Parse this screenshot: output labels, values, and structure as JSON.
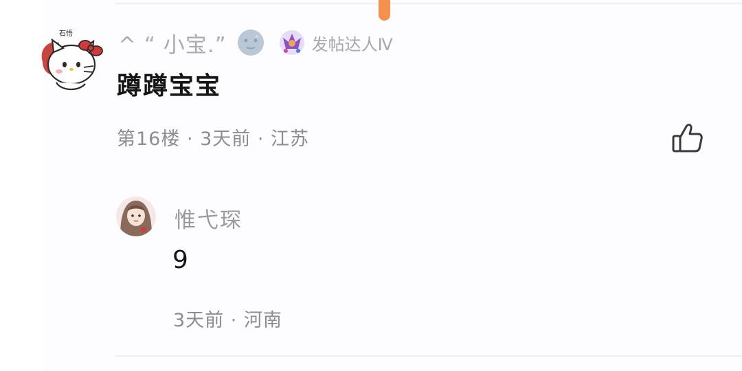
{
  "comment": {
    "username": "^ “ 小宝.”",
    "emoji_icon": "moon-face-icon",
    "badge_icon": "level-badge-icon",
    "badge_label": "发帖达人Ⅳ",
    "text": "蹲蹲宝宝",
    "meta": "第16楼 · 3天前 · 江苏",
    "like_icon": "thumbs-up-icon",
    "avatar_caption": "石悟"
  },
  "reply": {
    "username": "惟弋琛",
    "text": "9",
    "meta": "3天前 · 河南"
  },
  "colors": {
    "accent_scroll": "#f5914c",
    "username": "#aeaab2",
    "meta": "#8e8b93",
    "text": "#151515"
  }
}
